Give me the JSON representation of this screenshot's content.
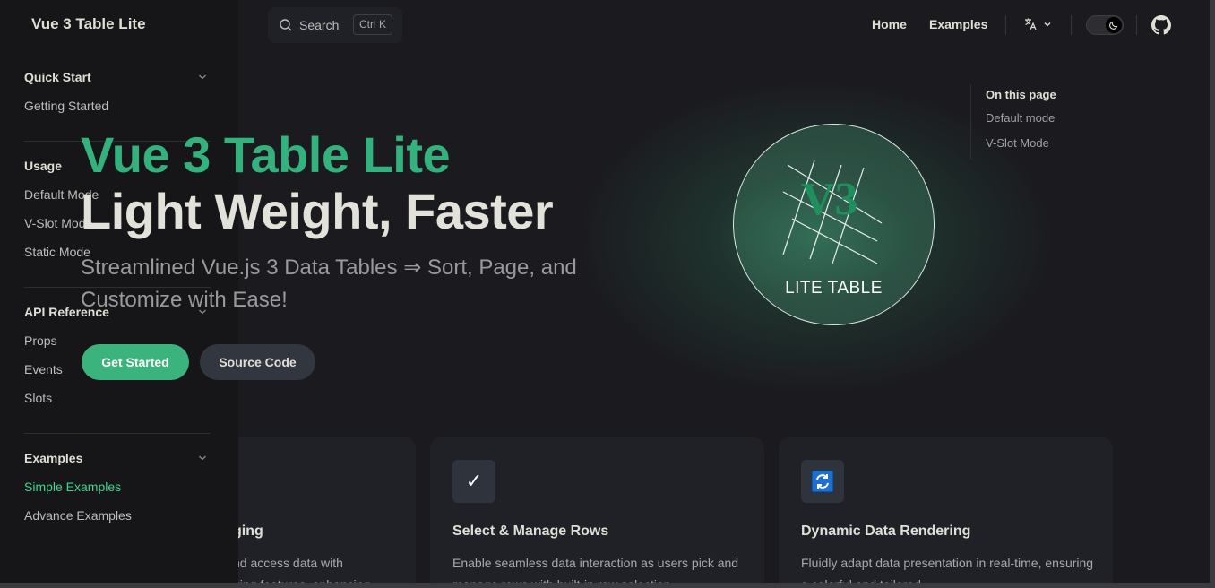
{
  "nav": {
    "brand": "Vue 3 Table Lite",
    "search": {
      "label": "Search",
      "shortcut": "Ctrl K"
    },
    "links": [
      "Home",
      "Examples"
    ]
  },
  "sidebar": {
    "groups": [
      {
        "title": "Quick Start",
        "items": [
          {
            "label": "Getting Started",
            "active": false
          }
        ]
      },
      {
        "title": "Usage",
        "items": [
          {
            "label": "Default Mode",
            "active": false
          },
          {
            "label": "V-Slot Mode",
            "active": false
          },
          {
            "label": "Static Mode",
            "active": false
          }
        ]
      },
      {
        "title": "API Reference",
        "items": [
          {
            "label": "Props",
            "active": false
          },
          {
            "label": "Events",
            "active": false
          },
          {
            "label": "Slots",
            "active": false
          }
        ]
      },
      {
        "title": "Examples",
        "items": [
          {
            "label": "Simple Examples",
            "active": true
          },
          {
            "label": "Advance Examples",
            "active": false
          }
        ]
      }
    ]
  },
  "hero": {
    "name": "Vue 3 Table Lite",
    "text": "Light Weight, Faster",
    "tagline": "Streamlined Vue.js 3 Data Tables ⇒ Sort, Page, and Customize with Ease!",
    "actions": [
      "Get Started",
      "Source Code"
    ],
    "logo": {
      "mark": "V3",
      "caption": "LITE TABLE"
    }
  },
  "outline": {
    "title": "On this page",
    "links": [
      "Default mode",
      "V-Slot Mode"
    ]
  },
  "features": [
    {
      "icon": "",
      "title": "ging",
      "details": "nd access data with\nging features, enhancing"
    },
    {
      "icon": "✓",
      "title": "Select & Manage Rows",
      "details": "Enable seamless data interaction as users pick and manage rows with built-in row selection"
    },
    {
      "icon": "refresh-icon",
      "title": "Dynamic Data Rendering",
      "details": "Fluidly adapt data presentation in real-time, ensuring a colorful and tailored"
    }
  ],
  "colors": {
    "brand": "#3bb37c",
    "bg": "#1b1b1f",
    "sidebar": "#161618"
  }
}
